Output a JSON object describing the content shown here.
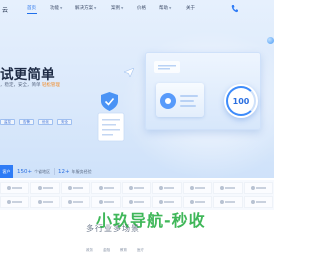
{
  "nav": {
    "logo": "云",
    "items": [
      {
        "label": "首页",
        "active": true
      },
      {
        "label": "功能",
        "caret": true
      },
      {
        "label": "解决方案",
        "caret": true
      },
      {
        "label": "案例",
        "caret": true
      },
      {
        "label": "价格"
      },
      {
        "label": "帮助",
        "caret": true
      },
      {
        "label": "关于"
      }
    ],
    "phone_icon": "phone-icon"
  },
  "hero": {
    "headline": "试更简单",
    "subline_prefix": "，稳定，安全，简单",
    "subline_highlight": "轻松管理",
    "tags": [
      "监控",
      "告警",
      "优化",
      "安全"
    ],
    "gauge_value": "100",
    "colors": {
      "accent": "#1f6feb",
      "highlight": "#f28c28"
    }
  },
  "stats": {
    "first": "客户",
    "items": [
      {
        "num": "150+",
        "unit": "个省地区"
      },
      {
        "num": "12+",
        "unit": "年服务经验"
      }
    ]
  },
  "bottom": {
    "title": "多行业多场景",
    "watermark": "小玖导航-秒收",
    "tabs": [
      "政务",
      "金融",
      "教育",
      "医疗"
    ]
  }
}
